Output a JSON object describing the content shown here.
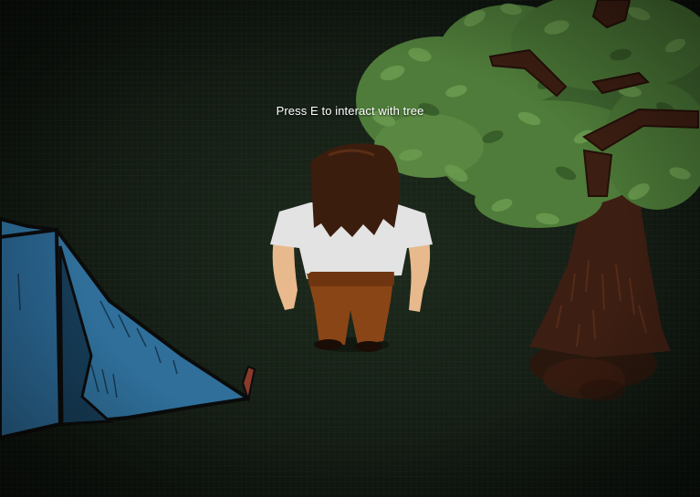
{
  "hud": {
    "interaction_prompt": "Press E to interact with tree"
  },
  "scene": {
    "objects": [
      "tent",
      "player-character",
      "tree"
    ]
  },
  "colors": {
    "ground": "#162016",
    "tent": "#2f6f9a",
    "foliage": "#4f7c3a",
    "trunk": "#3d1e12",
    "shirt": "#e3e3e3",
    "hair": "#3b1d0e",
    "pants": "#8a4516",
    "skin": "#e8b98c"
  }
}
